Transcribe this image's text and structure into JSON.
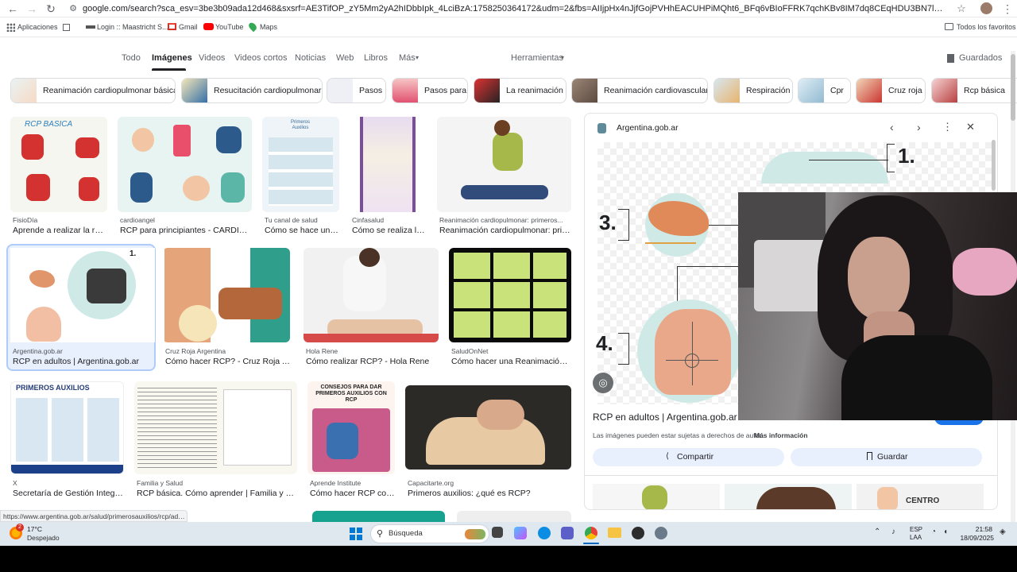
{
  "browser": {
    "url": "google.com/search?sca_esv=3be3b09ada12d468&sxsrf=AE3TifOP_zY5Mm2yA2hIDbbIpk_4LciBzA:1758250364172&udm=2&fbs=AIIjpHx4nJjfGojPVHhEACUHPiMQht6_BFq6vBIoFFRK7qchKBv8IM7dq8CEqHDU3BN7lbIo0LLC9Cn6mkAPuJ2pf_5AB2jIEfeNRohPjG4KBY...",
    "bookmarks": [
      "Aplicaciones",
      "Login :: Maastricht S...",
      "Gmail",
      "YouTube",
      "Maps"
    ],
    "all_bookmarks": "Todos los favoritos"
  },
  "tabs": [
    "Todo",
    "Imágenes",
    "Videos",
    "Videos cortos",
    "Noticias",
    "Web",
    "Libros",
    "Más"
  ],
  "tools": "Herramientas",
  "saved": "Guardados",
  "chips": [
    "Reanimación cardiopulmonar básica",
    "Resucitación cardiopulmonar",
    "Pasos",
    "Pasos para",
    "La reanimación",
    "Reanimación cardiovascular",
    "Respiración",
    "Cpr",
    "Cruz roja",
    "Rcp básica"
  ],
  "results": [
    {
      "source": "FisioDía",
      "title": "Aprende a realizar la rea...",
      "img_text": "RCP BASICA"
    },
    {
      "source": "cardioangel",
      "title": "RCP para principiantes - CARDIOA..."
    },
    {
      "source": "Tu canal de salud",
      "title": "Cómo se hace una...",
      "img_text": "Primeros Auxilios"
    },
    {
      "source": "Cinfasalud",
      "title": "Cómo se realiza la..."
    },
    {
      "source": "Reanimación cardiopulmonar: primeros...",
      "title": "Reanimación cardiopulmonar: prime..."
    },
    {
      "source": "Argentina.gob.ar",
      "title": "RCP en adultos | Argentina.gob.ar"
    },
    {
      "source": "Cruz Roja Argentina",
      "title": "Cómo hacer RCP? - Cruz Roja Ar..."
    },
    {
      "source": "Hola Rene",
      "title": "Cómo realizar RCP? - Hola Rene"
    },
    {
      "source": "SaludOnNet",
      "title": "Cómo hacer una Reanimación ..."
    },
    {
      "source": "X",
      "title": "Secretaría de Gestión Integra...",
      "img_text": "PRIMEROS AUXILIOS"
    },
    {
      "source": "Familia y Salud",
      "title": "RCP básica. Cómo aprender | Familia y Salud"
    },
    {
      "source": "Aprende Institute",
      "title": "Cómo hacer RCP corr...",
      "img_text": "CONSEJOS PARA DAR PRIMEROS AUXILIOS CON RCP"
    },
    {
      "source": "Capacitarte.org",
      "title": "Primeros auxilios: ¿qué es RCP?"
    }
  ],
  "panel": {
    "source": "Argentina.gob.ar",
    "title": "RCP en adultos | Argentina.gob.ar",
    "copyright": "Las imágenes pueden estar sujetas a derechos de autor.",
    "more_info": "Más información",
    "share": "Compartir",
    "save": "Guardar",
    "steps": [
      "1.",
      "3.",
      "4."
    ],
    "related_text": "CENTRO"
  },
  "status_url": "https://www.argentina.gob.ar/salud/primerosauxilios/rcp/adultos",
  "taskbar": {
    "temp": "17°C",
    "weather": "Despejado",
    "search": "Búsqueda",
    "lang": "ESP",
    "lang2": "LAA",
    "time": "21:58",
    "date": "18/09/2025",
    "badge": "2"
  }
}
